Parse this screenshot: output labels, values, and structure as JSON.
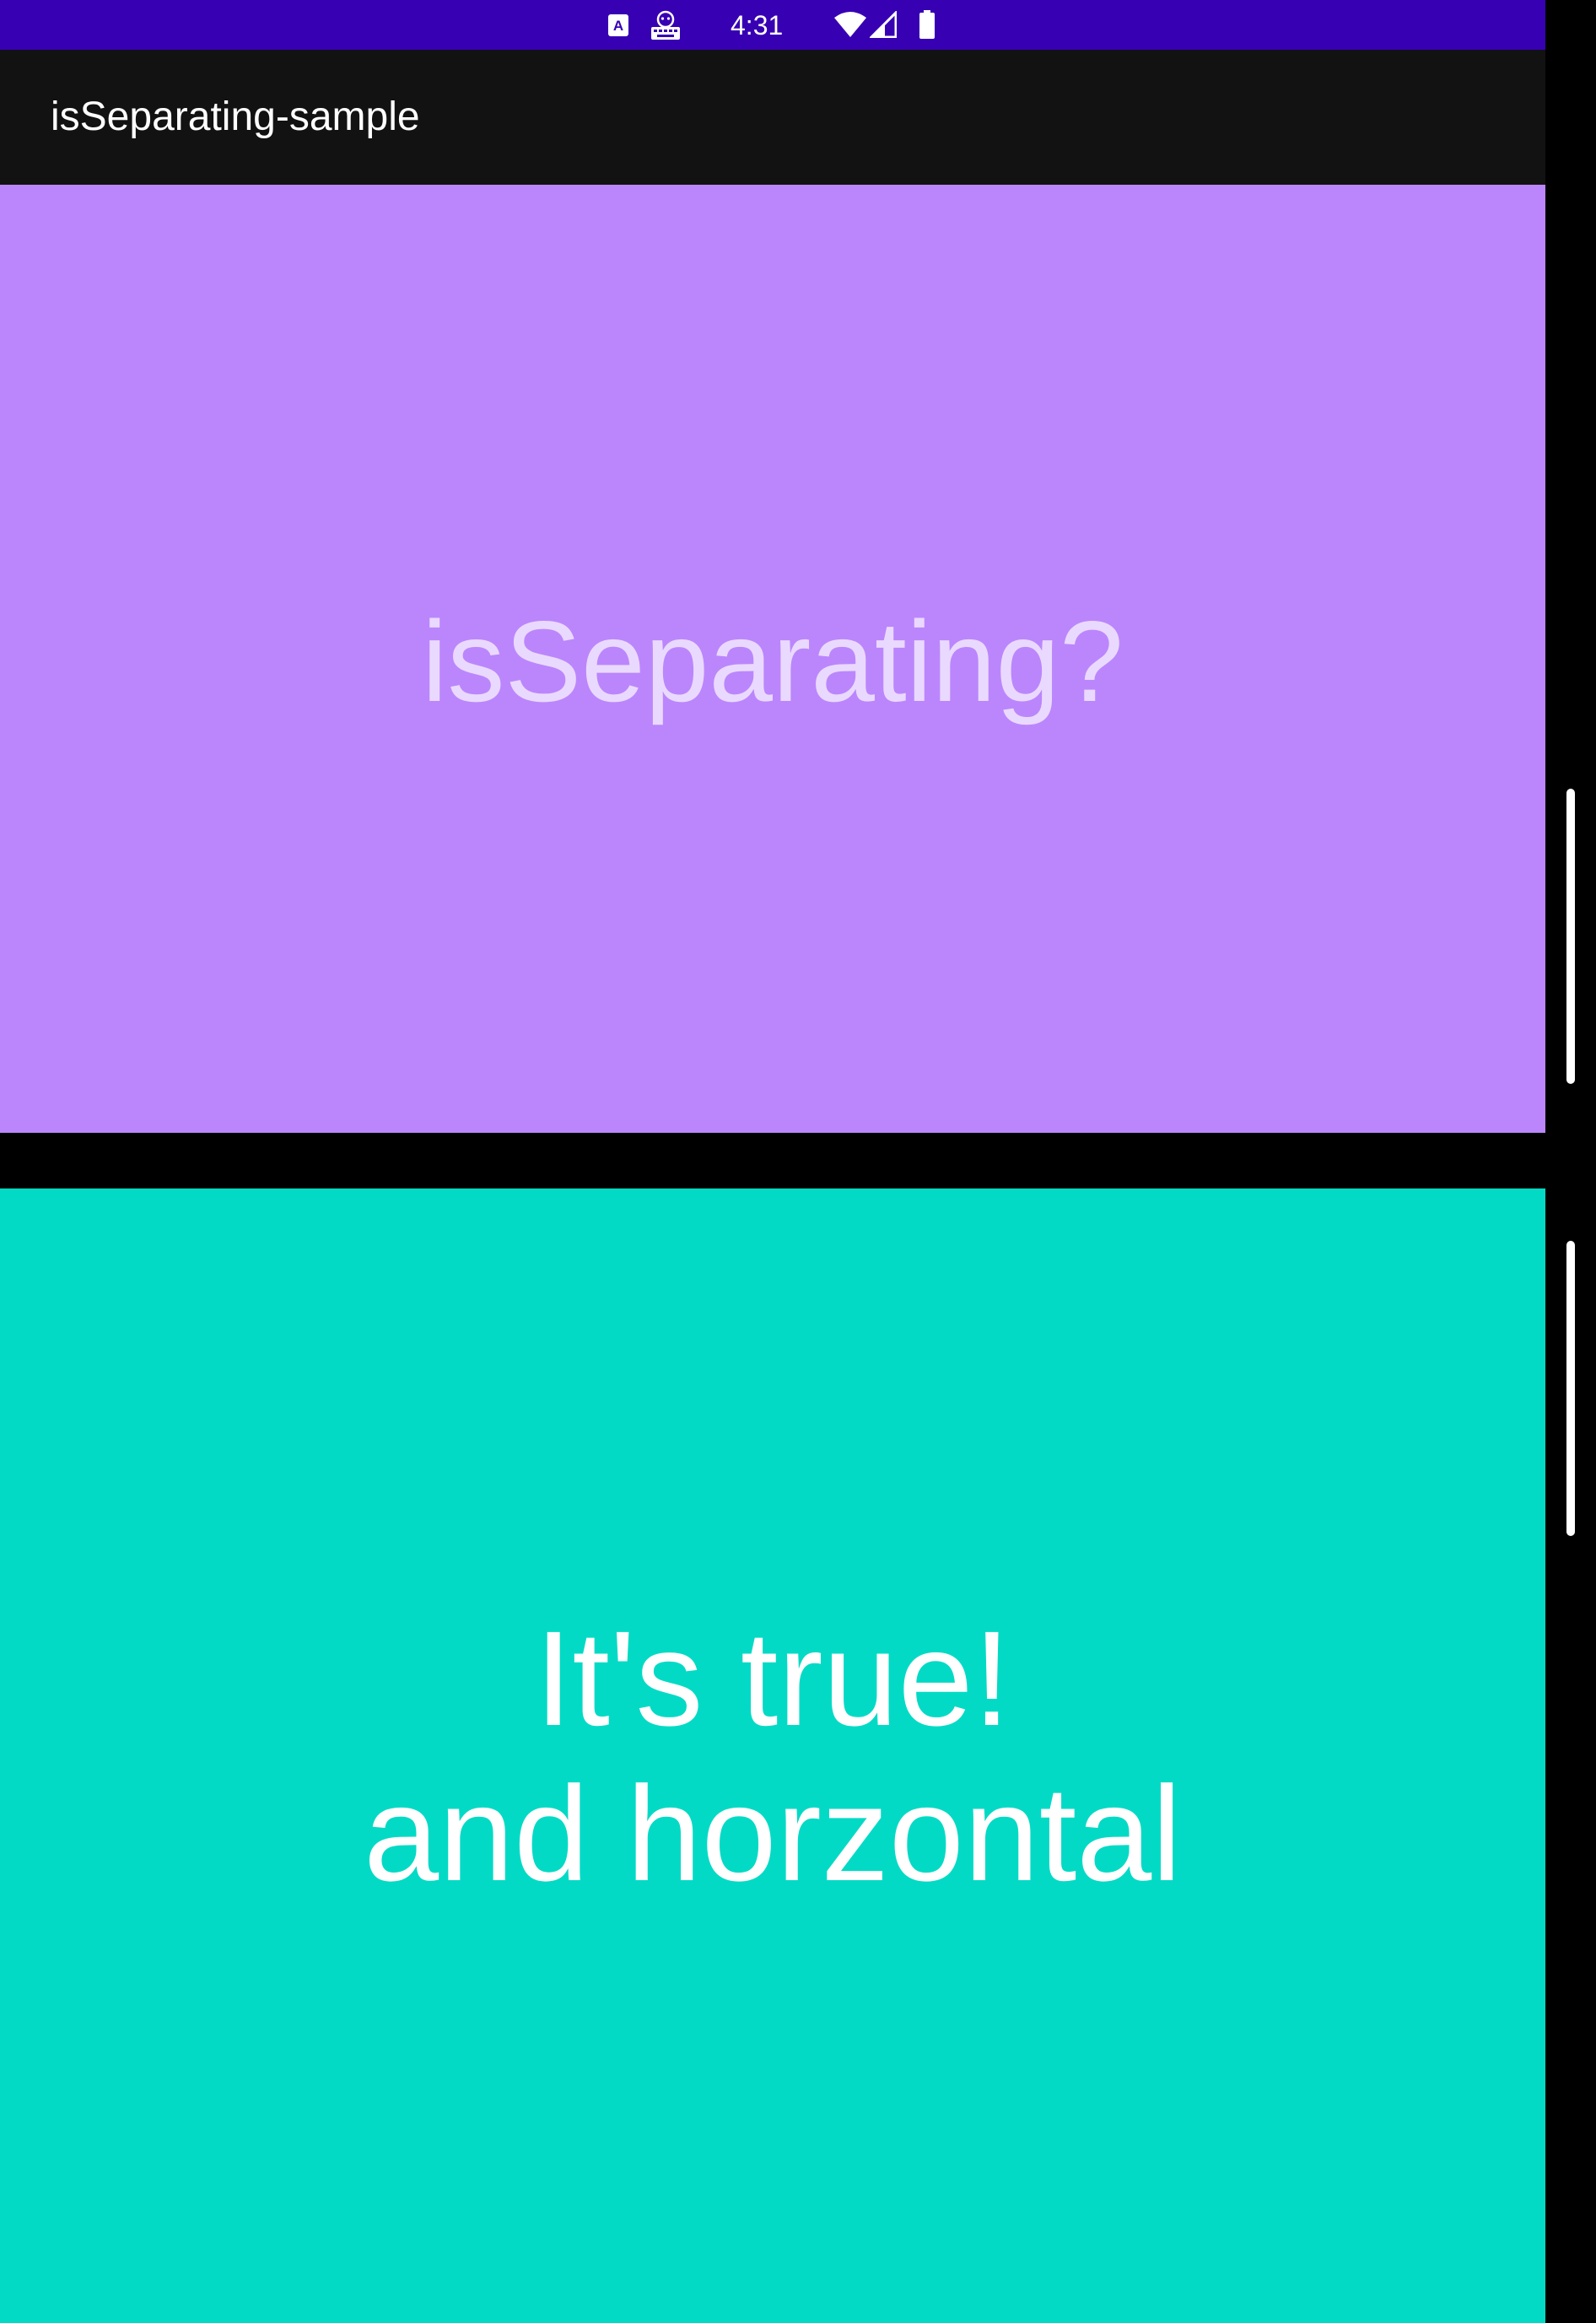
{
  "status_bar": {
    "time": "4:31",
    "background_color": "#3700b3",
    "icons": [
      "text-notification-icon",
      "keyboard-notification-icon",
      "wifi-icon",
      "cell-signal-icon",
      "battery-icon"
    ],
    "a_icon_letter": "A"
  },
  "app_bar": {
    "title": "isSeparating-sample",
    "background_color": "#121212"
  },
  "top_pane": {
    "text": "isSeparating?",
    "background_color": "#bb86fc"
  },
  "bottom_pane": {
    "line1": "It's true!",
    "line2": "and horzontal",
    "background_color": "#03dac5"
  }
}
